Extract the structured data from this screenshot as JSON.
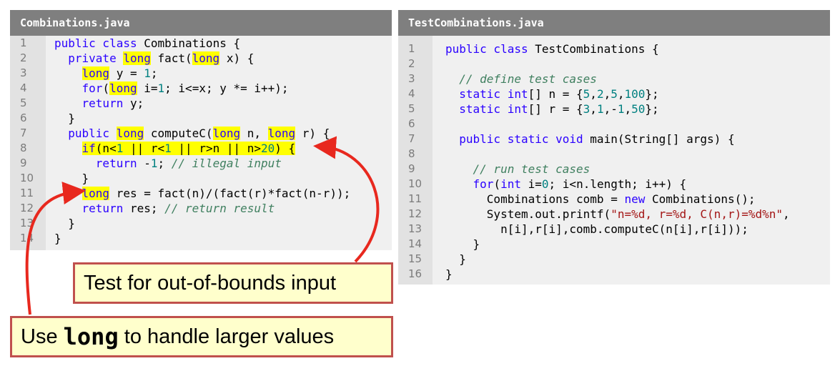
{
  "left_panel": {
    "title": "Combinations.java",
    "line_numbers": [
      "1",
      "2",
      "3",
      "4",
      "5",
      "6",
      "7",
      "8",
      "9",
      "10",
      "11",
      "12",
      "13",
      "14"
    ],
    "lines": [
      [
        {
          "t": "public class ",
          "c": "kw"
        },
        {
          "t": "Combinations {",
          "c": ""
        }
      ],
      [
        {
          "t": "  ",
          "c": ""
        },
        {
          "t": "private ",
          "c": "kw"
        },
        {
          "t": "long",
          "c": "hl-kw"
        },
        {
          "t": " fact(",
          "c": ""
        },
        {
          "t": "long",
          "c": "hl-kw"
        },
        {
          "t": " x) {",
          "c": ""
        }
      ],
      [
        {
          "t": "    ",
          "c": ""
        },
        {
          "t": "long",
          "c": "hl-kw"
        },
        {
          "t": " y = ",
          "c": ""
        },
        {
          "t": "1",
          "c": "num"
        },
        {
          "t": ";",
          "c": ""
        }
      ],
      [
        {
          "t": "    ",
          "c": ""
        },
        {
          "t": "for",
          "c": "kw"
        },
        {
          "t": "(",
          "c": ""
        },
        {
          "t": "long",
          "c": "hl-kw"
        },
        {
          "t": " i=",
          "c": ""
        },
        {
          "t": "1",
          "c": "num"
        },
        {
          "t": "; i<=x; y *= i++);",
          "c": ""
        }
      ],
      [
        {
          "t": "    ",
          "c": ""
        },
        {
          "t": "return",
          "c": "kw"
        },
        {
          "t": " y;",
          "c": ""
        }
      ],
      [
        {
          "t": "  }",
          "c": ""
        }
      ],
      [
        {
          "t": "  ",
          "c": ""
        },
        {
          "t": "public ",
          "c": "kw"
        },
        {
          "t": "long",
          "c": "hl-kw"
        },
        {
          "t": " computeC(",
          "c": ""
        },
        {
          "t": "long",
          "c": "hl-kw"
        },
        {
          "t": " n, ",
          "c": ""
        },
        {
          "t": "long",
          "c": "hl-kw"
        },
        {
          "t": " r) {",
          "c": ""
        }
      ],
      [
        {
          "t": "    ",
          "c": ""
        },
        {
          "t": "if",
          "c": "hl-kw"
        },
        {
          "t": "(n<",
          "c": "hl"
        },
        {
          "t": "1",
          "c": "hl-num"
        },
        {
          "t": " || r<",
          "c": "hl"
        },
        {
          "t": "1",
          "c": "hl-num"
        },
        {
          "t": " || r>n || n>",
          "c": "hl"
        },
        {
          "t": "20",
          "c": "hl-num"
        },
        {
          "t": ") {",
          "c": "hl"
        }
      ],
      [
        {
          "t": "      ",
          "c": ""
        },
        {
          "t": "return",
          "c": "kw"
        },
        {
          "t": " -",
          "c": ""
        },
        {
          "t": "1",
          "c": "num"
        },
        {
          "t": "; ",
          "c": ""
        },
        {
          "t": "// illegal input",
          "c": "cm"
        }
      ],
      [
        {
          "t": "    }",
          "c": ""
        }
      ],
      [
        {
          "t": "    ",
          "c": ""
        },
        {
          "t": "long",
          "c": "hl-kw"
        },
        {
          "t": " res = fact(n)/(fact(r)*fact(n-r));",
          "c": ""
        }
      ],
      [
        {
          "t": "    ",
          "c": ""
        },
        {
          "t": "return",
          "c": "kw"
        },
        {
          "t": " res; ",
          "c": ""
        },
        {
          "t": "// return result",
          "c": "cm"
        }
      ],
      [
        {
          "t": "  }",
          "c": ""
        }
      ],
      [
        {
          "t": "}",
          "c": ""
        }
      ]
    ]
  },
  "right_panel": {
    "title": "TestCombinations.java",
    "line_numbers": [
      "1",
      "2",
      "3",
      "4",
      "5",
      "6",
      "7",
      "8",
      "9",
      "10",
      "11",
      "12",
      "13",
      "14",
      "15",
      "16"
    ],
    "lines": [
      [
        {
          "t": "public class ",
          "c": "kw"
        },
        {
          "t": "TestCombinations {",
          "c": ""
        }
      ],
      [],
      [
        {
          "t": "  ",
          "c": ""
        },
        {
          "t": "// define test cases",
          "c": "cm"
        }
      ],
      [
        {
          "t": "  ",
          "c": ""
        },
        {
          "t": "static int",
          "c": "kw"
        },
        {
          "t": "[] n = {",
          "c": ""
        },
        {
          "t": "5",
          "c": "num"
        },
        {
          "t": ",",
          "c": ""
        },
        {
          "t": "2",
          "c": "num"
        },
        {
          "t": ",",
          "c": ""
        },
        {
          "t": "5",
          "c": "num"
        },
        {
          "t": ",",
          "c": ""
        },
        {
          "t": "100",
          "c": "num"
        },
        {
          "t": "};",
          "c": ""
        }
      ],
      [
        {
          "t": "  ",
          "c": ""
        },
        {
          "t": "static int",
          "c": "kw"
        },
        {
          "t": "[] r = {",
          "c": ""
        },
        {
          "t": "3",
          "c": "num"
        },
        {
          "t": ",",
          "c": ""
        },
        {
          "t": "1",
          "c": "num"
        },
        {
          "t": ",-",
          "c": ""
        },
        {
          "t": "1",
          "c": "num"
        },
        {
          "t": ",",
          "c": ""
        },
        {
          "t": "50",
          "c": "num"
        },
        {
          "t": "};",
          "c": ""
        }
      ],
      [],
      [
        {
          "t": "  ",
          "c": ""
        },
        {
          "t": "public static void ",
          "c": "kw"
        },
        {
          "t": "main(String[] args) {",
          "c": ""
        }
      ],
      [],
      [
        {
          "t": "    ",
          "c": ""
        },
        {
          "t": "// run test cases",
          "c": "cm"
        }
      ],
      [
        {
          "t": "    ",
          "c": ""
        },
        {
          "t": "for",
          "c": "kw"
        },
        {
          "t": "(",
          "c": ""
        },
        {
          "t": "int",
          "c": "kw"
        },
        {
          "t": " i=",
          "c": ""
        },
        {
          "t": "0",
          "c": "num"
        },
        {
          "t": "; i<n.length; i++) {",
          "c": ""
        }
      ],
      [
        {
          "t": "      Combinations comb = ",
          "c": ""
        },
        {
          "t": "new",
          "c": "kw"
        },
        {
          "t": " Combinations();",
          "c": ""
        }
      ],
      [
        {
          "t": "      System.out.printf(",
          "c": ""
        },
        {
          "t": "\"n=%d, r=%d, C(n,r)=%d%n\"",
          "c": "str"
        },
        {
          "t": ",",
          "c": ""
        }
      ],
      [
        {
          "t": "        n[i],r[i],comb.computeC(n[i],r[i]));",
          "c": ""
        }
      ],
      [
        {
          "t": "    }",
          "c": ""
        }
      ],
      [
        {
          "t": "  }",
          "c": ""
        }
      ],
      [
        {
          "t": "}",
          "c": ""
        }
      ]
    ]
  },
  "callouts": {
    "bounds_text": "Test for out-of-bounds input",
    "long_prefix": "Use ",
    "long_keyword": "long",
    "long_suffix": " to handle larger values"
  },
  "colors": {
    "header_bg": "#7f7f7f",
    "panel_bg": "#f0f0f0",
    "highlight": "#ffff00",
    "arrow": "#e8281e",
    "callout_border": "#c0504d",
    "callout_bg": "#ffffcc"
  }
}
